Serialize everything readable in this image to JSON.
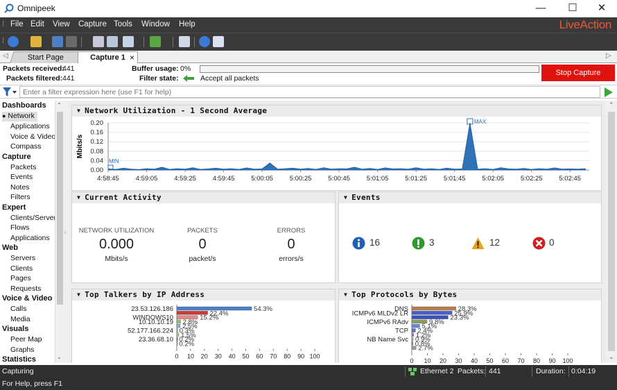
{
  "window": {
    "title": "Omnipeek",
    "minimize": "—",
    "maximize": "☐",
    "close": "✕"
  },
  "menubar": {
    "items": [
      "File",
      "Edit",
      "View",
      "Capture",
      "Tools",
      "Window",
      "Help"
    ],
    "brand": "LiveAction",
    "brand_color": "#e8573a"
  },
  "tabs": [
    {
      "label": "Start Page"
    },
    {
      "label": "Capture 1"
    }
  ],
  "capture_status": {
    "packets_received_label": "Packets received:",
    "packets_received": "441",
    "packets_filtered_label": "Packets filtered:",
    "packets_filtered": "441",
    "buffer_usage_label": "Buffer usage:",
    "buffer_usage": "0%",
    "filter_state_label": "Filter state:",
    "filter_state": "Accept all packets",
    "stop_button": "Stop Capture",
    "stop_button_color": "#e0120d"
  },
  "filter": {
    "placeholder": "Enter a filter expression here (use F1 for help)"
  },
  "sidebar": {
    "sections": [
      {
        "title": "Dashboards",
        "items": [
          "Network",
          "Applications",
          "Voice & Video",
          "Compass"
        ],
        "selected": "Network"
      },
      {
        "title": "Capture",
        "items": [
          "Packets",
          "Events",
          "Notes",
          "Filters"
        ]
      },
      {
        "title": "Expert",
        "items": [
          "Clients/Server",
          "Flows",
          "Applications"
        ]
      },
      {
        "title": "Web",
        "items": [
          "Servers",
          "Clients",
          "Pages",
          "Requests"
        ]
      },
      {
        "title": "Voice & Video",
        "items": [
          "Calls",
          "Media"
        ]
      },
      {
        "title": "Visuals",
        "items": [
          "Peer Map",
          "Graphs"
        ]
      },
      {
        "title": "Statistics",
        "items": []
      }
    ]
  },
  "panels": {
    "network_utilization": {
      "title": "Network Utilization - 1 Second Average",
      "ylabel": "Mbits/s",
      "yticks": [
        "0.20",
        "0.16",
        "0.12",
        "0.08",
        "0.04",
        "0.00"
      ],
      "xticks": [
        "4:58:45",
        "4:59:05",
        "4:59:25",
        "4:59:45",
        "5:00:05",
        "5:00:25",
        "5:00:45",
        "5:01:05",
        "5:01:25",
        "5:01:45",
        "5:02:05",
        "5:02:25",
        "5:02:45"
      ],
      "min_label": "MIN",
      "max_label": "MAX",
      "series_color": "#2f72b6"
    },
    "current_activity": {
      "title": "Current Activity",
      "metrics": [
        {
          "label": "NETWORK UTILIZATION",
          "value": "0.000",
          "unit": "Mbits/s"
        },
        {
          "label": "PACKETS",
          "value": "0",
          "unit": "packet/s"
        },
        {
          "label": "ERRORS",
          "value": "0",
          "unit": "errors/s"
        }
      ]
    },
    "events": {
      "title": "Events",
      "items": [
        {
          "icon": "info-icon",
          "count": "16",
          "color": "#1f5fb8"
        },
        {
          "icon": "check-icon",
          "count": "3",
          "color": "#2e9a2e"
        },
        {
          "icon": "warning-icon",
          "count": "12",
          "color": "#e8a317"
        },
        {
          "icon": "error-icon",
          "count": "0",
          "color": "#d11f1f"
        }
      ]
    },
    "top_talkers": {
      "title": "Top Talkers by IP Address",
      "axis_ticks": [
        "0",
        "10",
        "20",
        "30",
        "40",
        "50",
        "60",
        "70",
        "80",
        "90",
        "100"
      ]
    },
    "top_protocols": {
      "title": "Top Protocols by Bytes",
      "axis_ticks": [
        "0",
        "10",
        "20",
        "30",
        "40",
        "50",
        "60",
        "70",
        "80",
        "90",
        "100"
      ]
    }
  },
  "chart_data": [
    {
      "type": "area",
      "title": "Network Utilization - 1 Second Average",
      "ylabel": "Mbits/s",
      "ylim": [
        0,
        0.2
      ],
      "xlim": [
        "4:58:45",
        "5:02:55"
      ],
      "x_unit": "seconds from 4:58:45",
      "x": [
        0,
        4,
        8,
        12,
        16,
        20,
        24,
        28,
        32,
        36,
        40,
        44,
        48,
        52,
        56,
        60,
        64,
        68,
        72,
        76,
        80,
        84,
        88,
        92,
        96,
        100,
        104,
        108,
        112,
        116,
        120,
        124,
        128,
        132,
        136,
        140,
        144,
        148,
        152,
        156,
        160,
        164,
        168,
        172,
        176,
        180,
        184,
        188,
        192,
        196,
        200,
        204,
        208,
        212,
        216,
        220,
        224,
        228,
        232,
        236,
        240,
        244,
        248
      ],
      "values": [
        0.005,
        0.003,
        0.008,
        0.004,
        0.002,
        0.006,
        0.004,
        0.012,
        0.003,
        0.006,
        0.004,
        0.01,
        0.003,
        0.005,
        0.008,
        0.004,
        0.006,
        0.003,
        0.009,
        0.004,
        0.005,
        0.03,
        0.004,
        0.006,
        0.008,
        0.004,
        0.007,
        0.003,
        0.01,
        0.004,
        0.006,
        0.005,
        0.012,
        0.004,
        0.007,
        0.003,
        0.009,
        0.005,
        0.006,
        0.004,
        0.01,
        0.004,
        0.006,
        0.003,
        0.008,
        0.004,
        0.005,
        0.2,
        0.004,
        0.006,
        0.003,
        0.01,
        0.005,
        0.004,
        0.007,
        0.003,
        0.006,
        0.004,
        0.009,
        0.004,
        0.005,
        0.004,
        0.006
      ],
      "min_label": "MIN",
      "max_label": "MAX"
    },
    {
      "type": "bar",
      "title": "Top Talkers by IP Address",
      "xlim": [
        0,
        100
      ],
      "categories": [
        "23.53.126.186",
        "",
        "WINDOWS10",
        "10.10.10.19",
        "",
        "52.177.166.224",
        "",
        "23.36.68.10",
        ""
      ],
      "values": [
        54.3,
        22.4,
        15.2,
        2.8,
        2.5,
        0.3,
        1.5,
        0.2,
        0.2
      ],
      "value_labels": [
        "54.3%",
        "22.4%",
        "15.2%",
        "2.8%",
        "2.5%",
        "0.3%",
        "1.5%",
        "0.2%",
        "0.2%"
      ],
      "colors": [
        "#4a7ec9",
        "#c93a3a",
        "#e08a8a",
        "#8ec06c",
        "#7fb0d8",
        "#c6a0d0",
        "#9acd7a",
        "#888888",
        "#bbbbbb"
      ]
    },
    {
      "type": "bar",
      "title": "Top Protocols by Bytes",
      "xlim": [
        0,
        100
      ],
      "categories": [
        "DNS",
        "ICMPv6 MLDv2 LR",
        "",
        "ICMPv6 RAdv",
        "",
        "TCP",
        "",
        "NB Name Svc",
        ""
      ],
      "values": [
        28.3,
        25.9,
        23.3,
        9.8,
        5.1,
        2.4,
        1.2,
        0.9,
        0.8,
        2.7
      ],
      "value_labels": [
        "28.3%",
        "25.9%",
        "23.3%",
        "9.8%",
        "5.1%",
        "2.4%",
        "1.2%",
        "0.9%",
        "0.8%",
        "2.7%"
      ],
      "colors": [
        "#b77a4a",
        "#4a5fc9",
        "#3a52b8",
        "#8a9a5a",
        "#5a8ad8",
        "#6a6ab8",
        "#9a7ab8",
        "#aaaaaa",
        "#8a8a8a",
        "#999999"
      ]
    }
  ],
  "statusbar": {
    "state": "Capturing",
    "adapter": "Ethernet 2",
    "packets_label": "Packets:",
    "packets": "441",
    "duration_label": "Duration:",
    "duration": "0:04:19",
    "help": "For Help, press F1"
  }
}
